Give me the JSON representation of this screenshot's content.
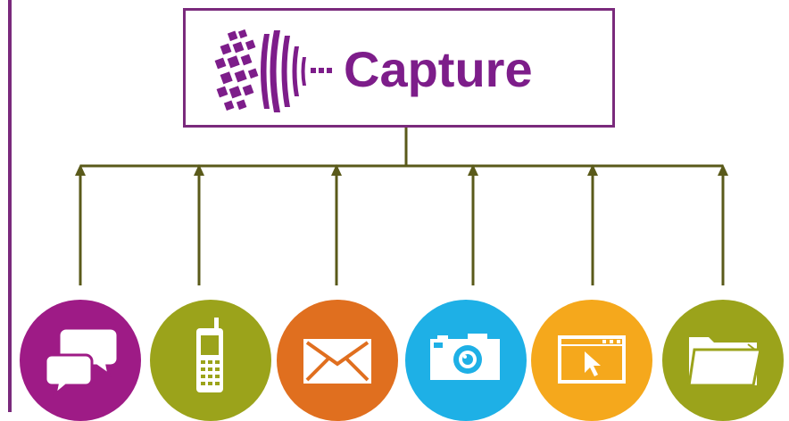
{
  "title": "Capture",
  "colors": {
    "border": "#7a2a7c",
    "brand": "#7d1d8a",
    "connector": "#5a5a1a",
    "chat": "#9e1b86",
    "phone": "#9ba31b",
    "email": "#e06f1f",
    "camera": "#1eb0e6",
    "web": "#f5a81c",
    "folder": "#9ba31b"
  },
  "channels": [
    {
      "icon": "chat-bubbles-icon",
      "color": "#9e1b86"
    },
    {
      "icon": "mobile-phone-icon",
      "color": "#9ba31b"
    },
    {
      "icon": "envelope-icon",
      "color": "#e06f1f"
    },
    {
      "icon": "camera-icon",
      "color": "#1eb0e6"
    },
    {
      "icon": "browser-window-icon",
      "color": "#f5a81c"
    },
    {
      "icon": "folder-icon",
      "color": "#9ba31b"
    }
  ]
}
